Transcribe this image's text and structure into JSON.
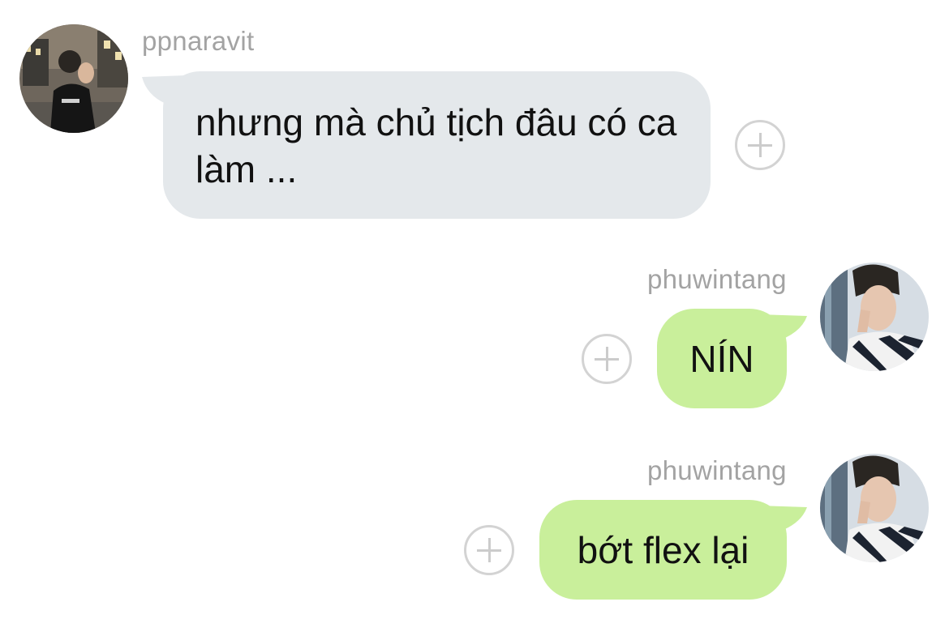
{
  "messages": [
    {
      "sender": "ppnaravit",
      "direction": "incoming",
      "text": "nhưng mà chủ tịch đâu có ca làm ..."
    },
    {
      "sender": "phuwintang",
      "direction": "outgoing",
      "text": "NÍN"
    },
    {
      "sender": "phuwintang",
      "direction": "outgoing",
      "text": "bớt flex lại"
    }
  ],
  "colors": {
    "incoming_bubble": "#e4e8eb",
    "outgoing_bubble": "#c9ef9b",
    "sender_name": "#a3a3a3",
    "add_icon": "#d3d3d3"
  },
  "icons": {
    "add": "plus-circle-icon"
  }
}
